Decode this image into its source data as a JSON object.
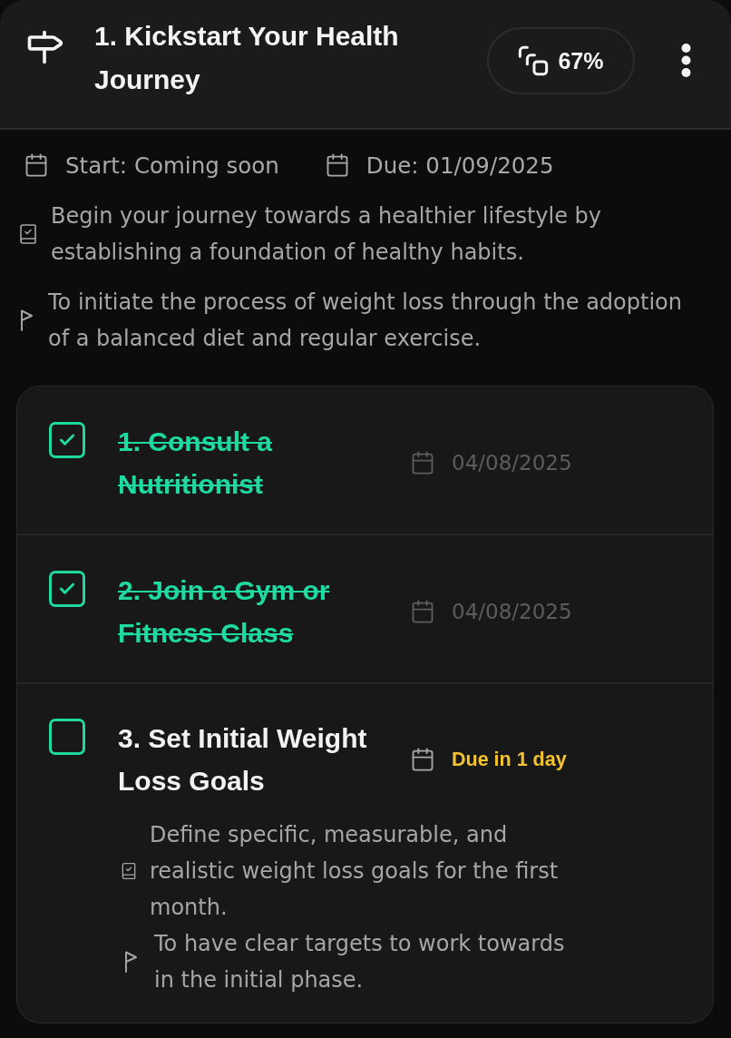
{
  "header": {
    "title": "1. Kickstart Your Health Journey",
    "progress": "67%"
  },
  "dates": {
    "start": "Start: Coming soon",
    "due": "Due: 01/09/2025"
  },
  "description": "Begin your journey towards a healthier lifestyle by establishing a foundation of healthy habits.",
  "goal": "To initiate the process of weight loss through the adoption of a balanced diet and regular exercise.",
  "subtasks": [
    {
      "title": "1. Consult a Nutritionist",
      "checked": true,
      "due": "04/08/2025",
      "due_soon": false
    },
    {
      "title": "2. Join a Gym or Fitness Class",
      "checked": true,
      "due": "04/08/2025",
      "due_soon": false
    },
    {
      "title": "3. Set Initial Weight Loss Goals",
      "checked": false,
      "due": "Due in 1 day",
      "due_soon": true,
      "description": "Define specific, measurable, and realistic weight loss goals for the first month.",
      "goal": "To have clear targets to work towards in the initial phase."
    }
  ]
}
